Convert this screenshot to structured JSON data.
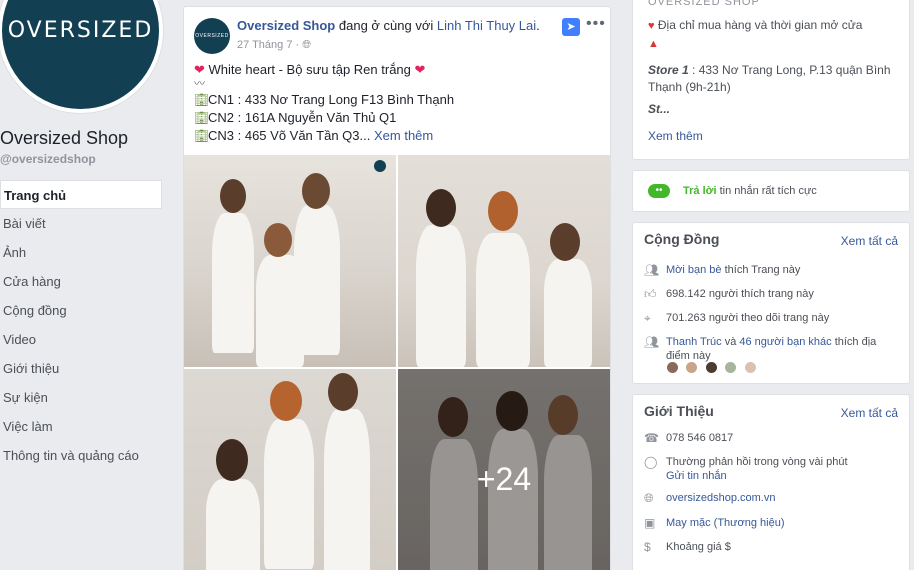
{
  "page": {
    "logo_text": "OVERSIZED",
    "name": "Oversized Shop",
    "handle": "@oversizedshop"
  },
  "nav": {
    "items": [
      {
        "label": "Trang chủ",
        "active": true
      },
      {
        "label": "Bài viết"
      },
      {
        "label": "Ảnh"
      },
      {
        "label": "Cửa hàng"
      },
      {
        "label": "Cộng đồng"
      },
      {
        "label": "Video"
      },
      {
        "label": "Giới thiệu"
      },
      {
        "label": "Sự kiện"
      },
      {
        "label": "Việc làm"
      },
      {
        "label": "Thông tin và quảng cáo"
      }
    ]
  },
  "post": {
    "avatar_text": "OVERSIZED",
    "author": "Oversized Shop",
    "with_text": "đang ở cùng với",
    "with_name": "Linh Thi Thuy Lai",
    "date": "27 Tháng 7",
    "line1": "White heart - Bộ sưu tập Ren trắng",
    "wave": "〰",
    "cn1": "CN1 : 433 Nơ Trang Long F13 Bình Thạnh",
    "cn2": "CN2 : 161A Nguyễn Văn Thủ Q1",
    "cn3": "CN3 : 465 Võ Văn Tần Q3...",
    "see_more": "Xem thêm",
    "more_photos": "+24"
  },
  "right": {
    "top_card_title": "OVERSIZED SHOP",
    "address_header": "Địa chỉ mua hàng và thời gian mở cửa",
    "store_label": "Store 1",
    "store_text": ": 433 Nơ Trang Long, P.13 quận Bình Thạnh (9h-21h)",
    "st_text": "St...",
    "see_more": "Xem thêm",
    "reply_status": "Trả lời",
    "reply_rest": "tin nhắn rất tích cực",
    "community": {
      "title": "Cộng Đồng",
      "see_all": "Xem tất cả",
      "invite": "Mời bạn bè",
      "invite_rest": "thích Trang này",
      "likes": "698.142 người thích trang này",
      "follows": "701.263 người theo dõi trang này",
      "friend_name": "Thanh Trúc",
      "friend_and": "và",
      "friend_count": "46 người bạn khác",
      "friend_rest": "thích địa điểm này"
    },
    "about": {
      "title": "Giới Thiệu",
      "see_all": "Xem tất cả",
      "phone": "078 546 0817",
      "response": "Thường phản hồi trong vòng vài phút",
      "send_msg": "Gửi tin nhắn",
      "website": "oversizedshop.com.vn",
      "category": "May mặc (Thương hiệu)",
      "price": "Khoảng giá $"
    }
  },
  "colors": {
    "brand_navy": "#123f52",
    "link": "#365899",
    "green": "#42b72a"
  }
}
